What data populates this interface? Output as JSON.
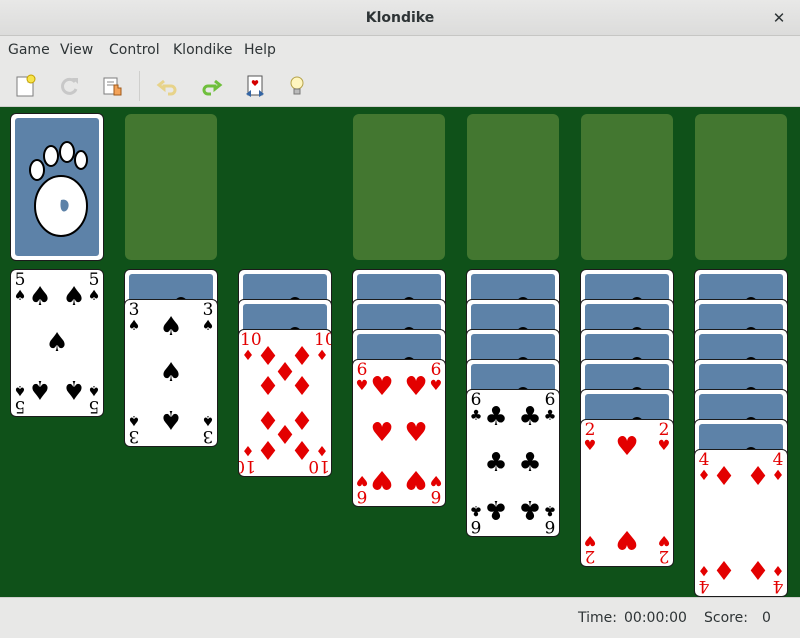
{
  "window": {
    "title": "Klondike"
  },
  "menu": [
    "Game",
    "View",
    "Control",
    "Klondike",
    "Help"
  ],
  "toolbar": [
    {
      "name": "new-game-button",
      "icon": "new-document-icon",
      "enabled": true
    },
    {
      "name": "restart-button",
      "icon": "restart-icon",
      "enabled": false
    },
    {
      "name": "select-game-button",
      "icon": "select-game-icon",
      "enabled": true
    },
    {
      "name": "undo-button",
      "icon": "undo-icon",
      "enabled": false
    },
    {
      "name": "redo-button",
      "icon": "redo-icon",
      "enabled": true
    },
    {
      "name": "deal-button",
      "icon": "deal-card-icon",
      "enabled": true
    },
    {
      "name": "hint-button",
      "icon": "hint-lightbulb-icon",
      "enabled": true
    }
  ],
  "table_color": "#0f5119",
  "stock": {
    "face": "down",
    "back_logo": "gnome-foot-icon"
  },
  "waste": {
    "empty": true
  },
  "foundations": [
    {
      "empty": true
    },
    {
      "empty": true
    },
    {
      "empty": true
    },
    {
      "empty": true
    }
  ],
  "tableau": [
    {
      "face_down": 0,
      "face_up": [
        {
          "rank": "5",
          "suit": "♠",
          "color": "black"
        }
      ]
    },
    {
      "face_down": 1,
      "face_up": [
        {
          "rank": "3",
          "suit": "♠",
          "color": "black"
        }
      ]
    },
    {
      "face_down": 2,
      "face_up": [
        {
          "rank": "10",
          "suit": "♦",
          "color": "red"
        }
      ]
    },
    {
      "face_down": 3,
      "face_up": [
        {
          "rank": "6",
          "suit": "♥",
          "color": "red"
        }
      ]
    },
    {
      "face_down": 4,
      "face_up": [
        {
          "rank": "6",
          "suit": "♣",
          "color": "black"
        }
      ]
    },
    {
      "face_down": 5,
      "face_up": [
        {
          "rank": "2",
          "suit": "♥",
          "color": "red"
        }
      ]
    },
    {
      "face_down": 6,
      "face_up": [
        {
          "rank": "4",
          "suit": "♦",
          "color": "red"
        }
      ]
    }
  ],
  "status": {
    "time_label": "Time:",
    "time_value": "00:00:00",
    "score_label": "Score:",
    "score_value": "0"
  }
}
